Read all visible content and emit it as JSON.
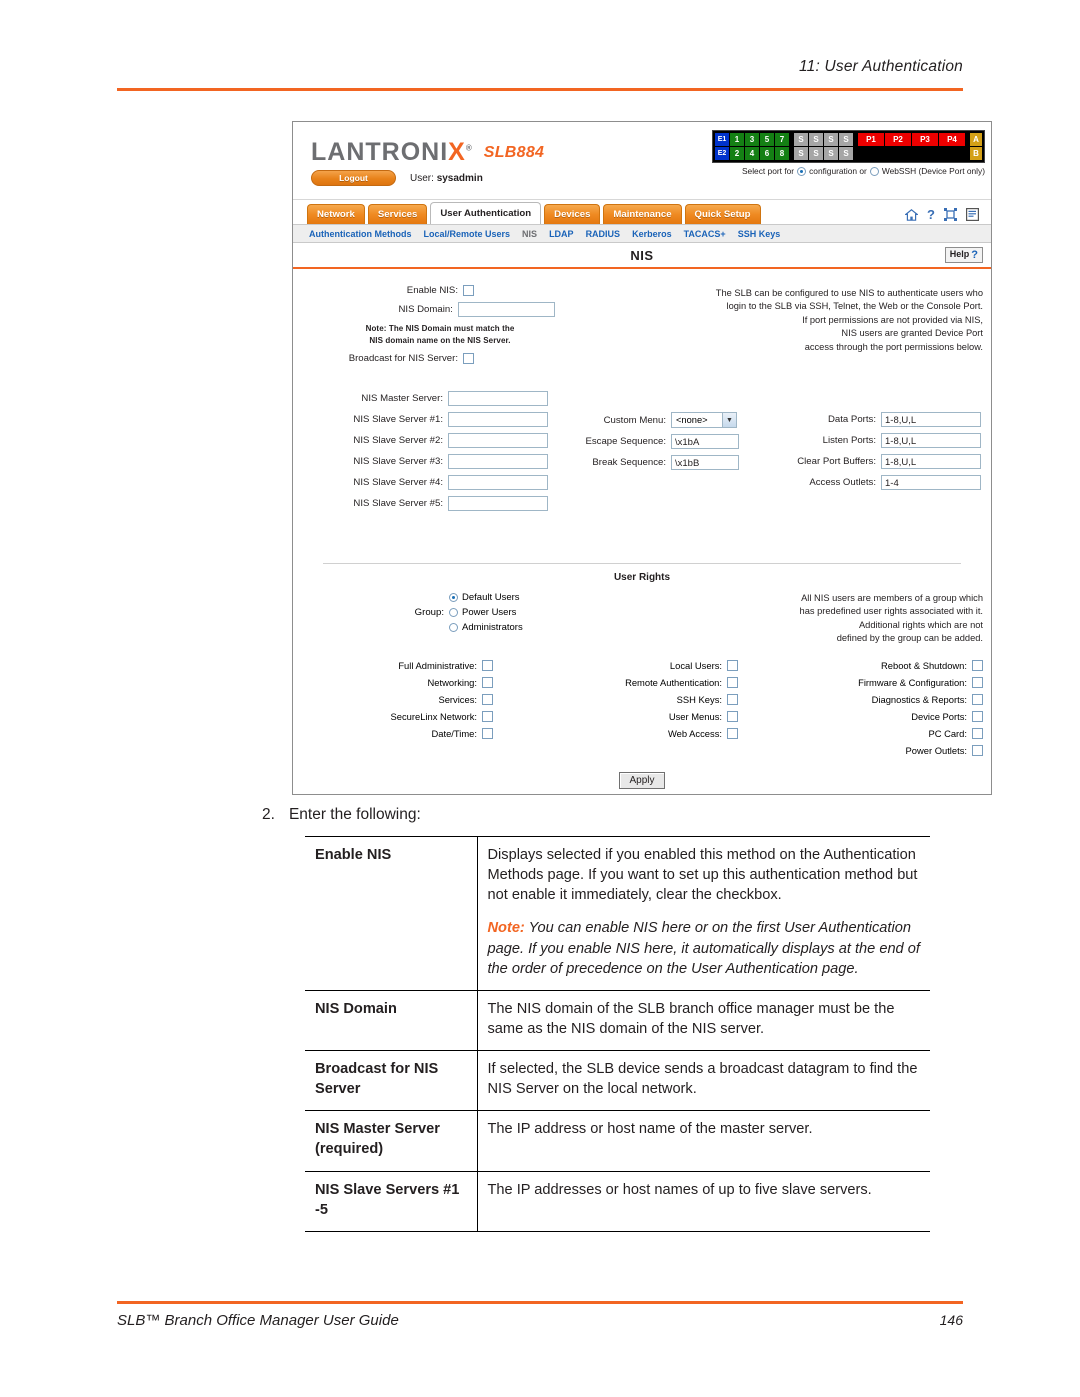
{
  "document": {
    "header": "11: User Authentication",
    "footer_left": "SLB™ Branch Office Manager User Guide",
    "footer_page": "146",
    "step_number": "2.",
    "step_text": "Enter the following:"
  },
  "app": {
    "logo": "LANTRONIX",
    "logo_reg": "®",
    "model": "SLB884",
    "logout_label": "Logout",
    "user_label": "User:",
    "user_name": "sysadmin",
    "ports": {
      "row1": [
        "E1",
        "1",
        "3",
        "5",
        "7",
        "S",
        "S",
        "S",
        "S",
        "P1",
        "P2",
        "P3",
        "P4",
        "A"
      ],
      "row2": [
        "E2",
        "2",
        "4",
        "6",
        "8",
        "S",
        "S",
        "S",
        "S",
        "B"
      ],
      "select_prefix": "Select port for",
      "option_config": "configuration or",
      "option_webssh": "WebSSH (Device Port only)",
      "selected": "configuration"
    },
    "tabs": [
      {
        "label": "Network",
        "active": false
      },
      {
        "label": "Services",
        "active": false
      },
      {
        "label": "User Authentication",
        "active": true
      },
      {
        "label": "Devices",
        "active": false
      },
      {
        "label": "Maintenance",
        "active": false
      },
      {
        "label": "Quick Setup",
        "active": false
      }
    ],
    "toolbar_icons": [
      "home-icon",
      "help-question-icon",
      "expand-icon",
      "log-icon"
    ],
    "subnav": [
      {
        "label": "Authentication Methods",
        "current": false
      },
      {
        "label": "Local/Remote Users",
        "current": false
      },
      {
        "label": "NIS",
        "current": true
      },
      {
        "label": "LDAP",
        "current": false
      },
      {
        "label": "RADIUS",
        "current": false
      },
      {
        "label": "Kerberos",
        "current": false
      },
      {
        "label": "TACACS+",
        "current": false
      },
      {
        "label": "SSH Keys",
        "current": false
      }
    ],
    "pane": {
      "title": "NIS",
      "help_label": "Help",
      "help_mark": "?"
    },
    "form": {
      "enable_nis_label": "Enable NIS:",
      "enable_nis_checked": false,
      "nis_domain_label": "NIS Domain:",
      "nis_domain_value": "",
      "nis_domain_note_line1": "Note: The NIS Domain must match the",
      "nis_domain_note_line2": "NIS domain name on the NIS Server.",
      "broadcast_label": "Broadcast for NIS Server:",
      "broadcast_checked": false,
      "master_label": "NIS Master Server:",
      "master_value": "",
      "slaves": [
        {
          "label": "NIS Slave Server #1:",
          "value": ""
        },
        {
          "label": "NIS Slave Server #2:",
          "value": ""
        },
        {
          "label": "NIS Slave Server #3:",
          "value": ""
        },
        {
          "label": "NIS Slave Server #4:",
          "value": ""
        },
        {
          "label": "NIS Slave Server #5:",
          "value": ""
        }
      ],
      "intro_lines": [
        "The SLB can be configured to use NIS to authenticate users who",
        "login to the SLB via SSH, Telnet, the Web or the Console Port.",
        "If port permissions are not provided via NIS,",
        "NIS users are granted Device Port",
        "access through the port permissions below."
      ],
      "custom_menu_label": "Custom Menu:",
      "custom_menu_value": "<none>",
      "escape_label": "Escape Sequence:",
      "escape_value": "\\x1bA",
      "break_label": "Break Sequence:",
      "break_value": "\\x1bB",
      "data_ports_label": "Data Ports:",
      "data_ports_value": "1-8,U,L",
      "listen_ports_label": "Listen Ports:",
      "listen_ports_value": "1-8,U,L",
      "clear_buffers_label": "Clear Port Buffers:",
      "clear_buffers_value": "1-8,U,L",
      "access_outlets_label": "Access Outlets:",
      "access_outlets_value": "1-4"
    },
    "user_rights": {
      "title": "User Rights",
      "group_label": "Group:",
      "groups": [
        {
          "label": "Default Users",
          "selected": true
        },
        {
          "label": "Power Users",
          "selected": false
        },
        {
          "label": "Administrators",
          "selected": false
        }
      ],
      "description_lines": [
        "All NIS users are members of a group which",
        "has predefined user rights associated with it.",
        "Additional rights which are not",
        "defined by the group can be added."
      ],
      "permissions_col1": [
        {
          "label": "Full Administrative:",
          "checked": false
        },
        {
          "label": "Networking:",
          "checked": false
        },
        {
          "label": "Services:",
          "checked": false
        },
        {
          "label": "SecureLinx Network:",
          "checked": false
        },
        {
          "label": "Date/Time:",
          "checked": false
        }
      ],
      "permissions_col2": [
        {
          "label": "Local Users:",
          "checked": false
        },
        {
          "label": "Remote Authentication:",
          "checked": false
        },
        {
          "label": "SSH Keys:",
          "checked": false
        },
        {
          "label": "User Menus:",
          "checked": false
        },
        {
          "label": "Web Access:",
          "checked": false
        }
      ],
      "permissions_col3": [
        {
          "label": "Reboot & Shutdown:",
          "checked": false
        },
        {
          "label": "Firmware & Configuration:",
          "checked": false
        },
        {
          "label": "Diagnostics & Reports:",
          "checked": false
        },
        {
          "label": "Device Ports:",
          "checked": false
        },
        {
          "label": "PC Card:",
          "checked": false
        },
        {
          "label": "Power Outlets:",
          "checked": false
        }
      ],
      "apply_label": "Apply"
    }
  },
  "table": {
    "rows": [
      {
        "term": "Enable NIS",
        "paragraphs": [
          "Displays selected if you enabled this method on the Authentication Methods page. If you want to set up this authentication method but not enable it immediately, clear the checkbox."
        ],
        "note_lead": "Note:",
        "note_text": " You can enable NIS here or on the first User Authentication page. If you enable NIS here, it automatically displays at the end of the order of precedence on the User Authentication page."
      },
      {
        "term": "NIS Domain",
        "paragraphs": [
          "The NIS domain of the SLB branch office manager must be the same as the NIS domain of the NIS server."
        ]
      },
      {
        "term": "Broadcast for NIS Server",
        "paragraphs": [
          "If selected, the SLB device sends a broadcast datagram to find the NIS Server on the local network."
        ]
      },
      {
        "term": "NIS Master Server (required)",
        "paragraphs": [
          "The IP address or host name of the master server."
        ]
      },
      {
        "term": "NIS Slave Servers #1 -5",
        "paragraphs": [
          "The IP addresses or host names of up to five slave servers."
        ]
      }
    ]
  }
}
